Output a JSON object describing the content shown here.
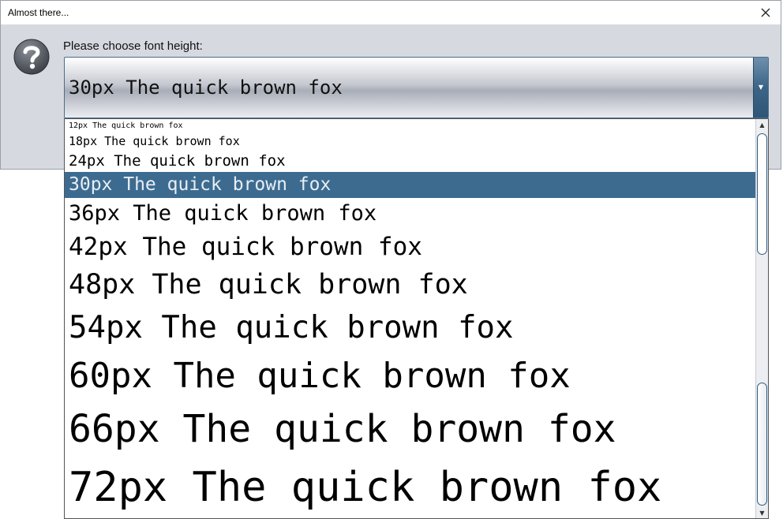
{
  "window": {
    "title": "Almost there..."
  },
  "prompt": {
    "label": "Please choose font height:"
  },
  "combo": {
    "value": "30px The quick brown fox"
  },
  "options": [
    "12px The quick brown fox",
    "18px The quick brown fox",
    "24px The quick brown fox",
    "30px The quick brown fox",
    "36px The quick brown fox",
    "42px The quick brown fox",
    "48px The quick brown fox",
    "54px The quick brown fox",
    "60px The quick brown fox",
    "66px The quick brown fox",
    "72px The quick brown fox"
  ],
  "selected_index": 3,
  "icons": {
    "close": "close-icon",
    "question": "question-icon",
    "dropdown": "chevron-down-icon"
  },
  "colors": {
    "selection": "#3d6b90",
    "accent": "#3b6486"
  }
}
